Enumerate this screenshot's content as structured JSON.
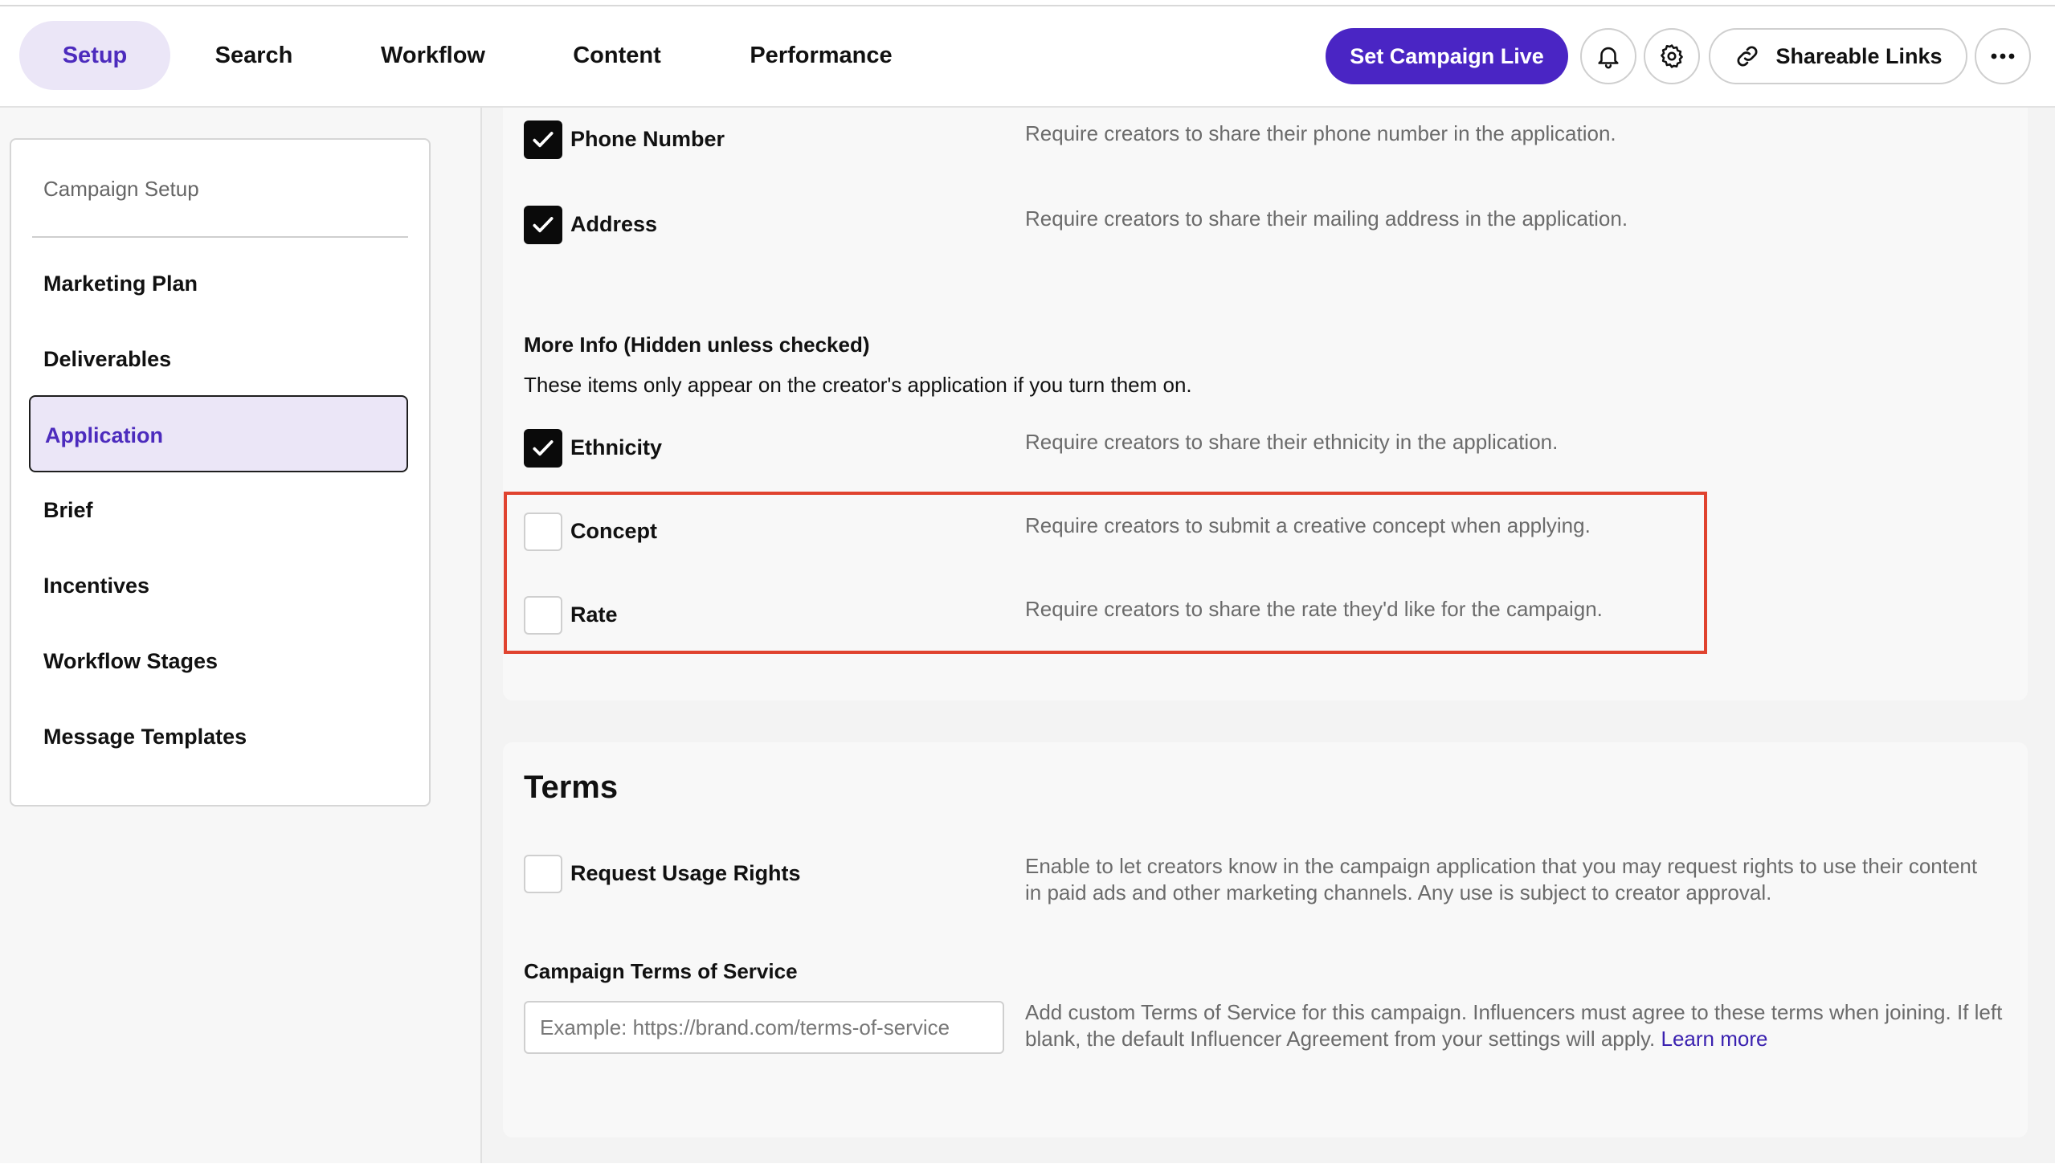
{
  "header": {
    "tabs": [
      {
        "label": "Setup",
        "active": true
      },
      {
        "label": "Search"
      },
      {
        "label": "Workflow"
      },
      {
        "label": "Content"
      },
      {
        "label": "Performance"
      }
    ],
    "set_live_label": "Set Campaign Live",
    "shareable_links_label": "Shareable Links",
    "icons": [
      "bell-icon",
      "gear-icon",
      "link-icon",
      "more-horizontal-icon"
    ]
  },
  "sidebar": {
    "heading": "Campaign Setup",
    "items": [
      {
        "label": "Marketing Plan"
      },
      {
        "label": "Deliverables"
      },
      {
        "label": "Application",
        "active": true
      },
      {
        "label": "Brief"
      },
      {
        "label": "Incentives"
      },
      {
        "label": "Workflow Stages"
      },
      {
        "label": "Message Templates"
      }
    ]
  },
  "application": {
    "options": [
      {
        "label": "Phone Number",
        "checked": true,
        "description": "Require creators to share their phone number in the application."
      },
      {
        "label": "Address",
        "checked": true,
        "description": "Require creators to share their mailing address in the application."
      }
    ],
    "more_info": {
      "title": "More Info (Hidden unless checked)",
      "subtitle": "These items only appear on the creator's application if you turn them on.",
      "options": [
        {
          "label": "Ethnicity",
          "checked": true,
          "description": "Require creators to share their ethnicity in the application."
        },
        {
          "label": "Concept",
          "checked": false,
          "description": "Require creators to submit a creative concept when applying."
        },
        {
          "label": "Rate",
          "checked": false,
          "description": "Require creators to share the rate they'd like for the campaign."
        }
      ]
    }
  },
  "terms": {
    "title": "Terms",
    "usage_rights": {
      "label": "Request Usage Rights",
      "checked": false,
      "description": "Enable to let creators know in the campaign application that you may request rights to use their content in paid ads and other marketing channels. Any use is subject to creator approval."
    },
    "tos": {
      "label": "Campaign Terms of Service",
      "value": "",
      "placeholder": "Example: https://brand.com/terms-of-service",
      "description": "Add custom Terms of Service for this campaign. Influencers must agree to these terms when joining. If left blank, the default Influencer Agreement from your settings will apply.",
      "learn_more": "Learn more"
    }
  },
  "colors": {
    "accent": "#4a25c4",
    "active_tab_bg": "#ebe6f7",
    "active_text": "#4c2bbd",
    "highlight_border": "#e0432f"
  }
}
